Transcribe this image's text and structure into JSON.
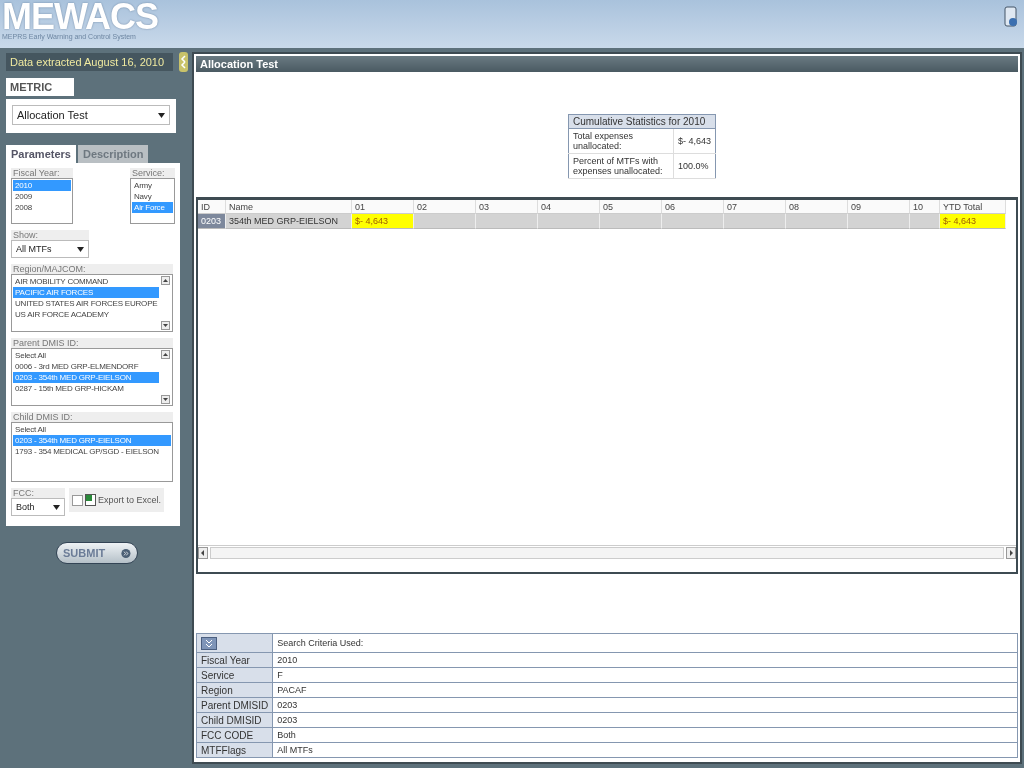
{
  "header": {
    "logo": "MEWACS",
    "subtitle": "MEPRS Early Warning and Control System"
  },
  "sidebar": {
    "extracted": "Data extracted August 16, 2010",
    "metric_label": "METRIC",
    "metric_value": "Allocation Test",
    "tabs": [
      {
        "label": "Parameters",
        "selected": true
      },
      {
        "label": "Description",
        "selected": false
      }
    ],
    "fiscal_year": {
      "label": "Fiscal Year:",
      "scrollbar": false,
      "options": [
        {
          "label": "2010",
          "selected": true
        },
        {
          "label": "2009",
          "selected": false
        },
        {
          "label": "2008",
          "selected": false
        }
      ]
    },
    "service": {
      "label": "Service:",
      "scrollbar": false,
      "options": [
        {
          "label": "Army",
          "selected": false
        },
        {
          "label": "Navy",
          "selected": false
        },
        {
          "label": "Air Force",
          "selected": true
        }
      ]
    },
    "show": {
      "label": "Show:",
      "value": "All MTFs"
    },
    "region": {
      "label": "Region/MAJCOM:",
      "scrollbar": true,
      "options": [
        {
          "label": "AIR MOBILITY COMMAND",
          "selected": false
        },
        {
          "label": "PACIFIC AIR FORCES",
          "selected": true
        },
        {
          "label": "UNITED STATES AIR FORCES EUROPE",
          "selected": false
        },
        {
          "label": "US AIR FORCE ACADEMY",
          "selected": false
        }
      ]
    },
    "parent_dmis": {
      "label": "Parent DMIS ID:",
      "scrollbar": true,
      "options": [
        {
          "label": "Select All",
          "selected": false
        },
        {
          "label": "0006 - 3rd MED GRP-ELMENDORF",
          "selected": false
        },
        {
          "label": "0203 - 354th MED GRP-EIELSON",
          "selected": true
        },
        {
          "label": "0287 - 15th MED GRP-HICKAM",
          "selected": false
        }
      ]
    },
    "child_dmis": {
      "label": "Child DMIS ID:",
      "scrollbar": false,
      "options": [
        {
          "label": "Select All",
          "selected": false
        },
        {
          "label": "0203 - 354th MED GRP-EIELSON",
          "selected": true
        },
        {
          "label": "1793 - 354 MEDICAL GP/SGD - EIELSON",
          "selected": false
        }
      ]
    },
    "fcc": {
      "label": "FCC:",
      "value": "Both"
    },
    "export": {
      "label": "Export to Excel.",
      "checked": false
    },
    "submit": "SUBMIT"
  },
  "main": {
    "title": "Allocation Test",
    "stats": {
      "title": "Cumulative Statistics for 2010",
      "rows": [
        {
          "label": "Total expenses unallocated:",
          "value": "$- 4,643"
        },
        {
          "label": "Percent of MTFs with expenses unallocated:",
          "value": "100.0%"
        }
      ]
    },
    "grid": {
      "columns": [
        "ID",
        "Name",
        "01",
        "02",
        "03",
        "04",
        "05",
        "06",
        "07",
        "08",
        "09",
        "10",
        "YTD Total"
      ],
      "rows": [
        {
          "cells": [
            {
              "value": "0203",
              "highlighted": false
            },
            {
              "value": "354th MED GRP-EIELSON",
              "highlighted": false
            },
            {
              "value": "$- 4,643",
              "highlighted": true
            },
            {
              "highlighted": false
            },
            {
              "highlighted": false
            },
            {
              "highlighted": false
            },
            {
              "highlighted": false
            },
            {
              "highlighted": false
            },
            {
              "highlighted": false
            },
            {
              "highlighted": false
            },
            {
              "highlighted": false
            },
            {
              "highlighted": false
            },
            {
              "value": "$- 4,643",
              "highlighted": true
            }
          ]
        }
      ]
    },
    "criteria": {
      "title": "Search Criteria Used:",
      "rows": [
        {
          "label": "Fiscal Year",
          "value": "2010"
        },
        {
          "label": "Service",
          "value": "F"
        },
        {
          "label": "Region",
          "value": "PACAF"
        },
        {
          "label": "Parent DMISID",
          "value": "0203"
        },
        {
          "label": "Child DMISID",
          "value": "0203"
        },
        {
          "label": "FCC CODE",
          "value": "Both"
        },
        {
          "label": "MTFFlags",
          "value": "All MTFs"
        }
      ]
    }
  }
}
